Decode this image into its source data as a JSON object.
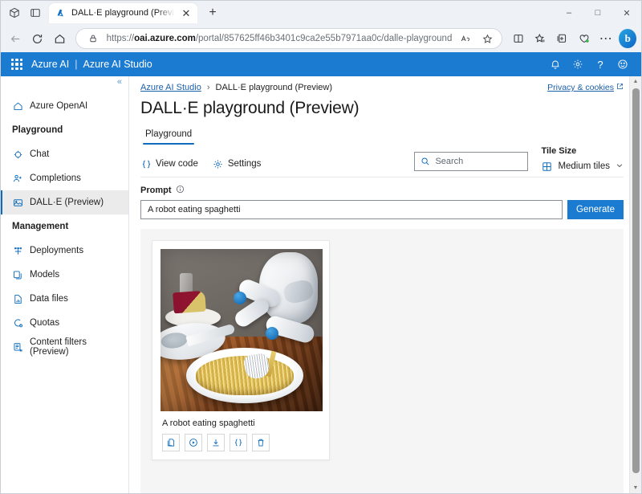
{
  "browser": {
    "tab": {
      "title": "DALL·E playground (Preview) | A…",
      "favicon_icon": "azure-logo-icon",
      "close_icon": "close-icon"
    },
    "new_tab_icon": "plus-icon",
    "tab_search_icon": "tab-search-icon",
    "tab_actions_icon": "tab-actions-icon",
    "nav": {
      "back_icon": "arrow-left-icon",
      "refresh_icon": "refresh-icon",
      "home_icon": "home-icon"
    },
    "omnibox": {
      "lock_icon": "lock-icon",
      "url_prefix": "https://",
      "url_domain": "oai.azure.com",
      "url_path": "/portal/857625ff46b3401c9ca2e55b7971aa0c/dalle-playground",
      "read_aloud_icon": "read-aloud-icon",
      "favorite_icon": "star-icon"
    },
    "toolbar_icons": [
      "split-screen-icon",
      "favorites-icon",
      "collections-icon",
      "browser-essentials-icon",
      "settings-more-icon",
      "copilot-icon"
    ],
    "window_controls": {
      "minimize": "–",
      "maximize": "□",
      "close": "✕"
    }
  },
  "azure_header": {
    "waffle_icon": "app-launcher-icon",
    "brand": "Azure AI",
    "separator": "|",
    "product": "Azure AI Studio",
    "actions": [
      {
        "name": "notifications-icon",
        "glyph": "⮝"
      },
      {
        "name": "settings-gear-icon",
        "glyph": "⚙"
      },
      {
        "name": "help-icon",
        "glyph": "?"
      },
      {
        "name": "feedback-icon",
        "glyph": "☺"
      }
    ]
  },
  "sidebar": {
    "collapse_icon": "chevron-double-left-icon",
    "collapse_glyph": "«",
    "items": [
      {
        "label": "Azure OpenAI",
        "icon": "home-icon",
        "type": "link",
        "active": false
      },
      {
        "label": "Playground",
        "type": "group"
      },
      {
        "label": "Chat",
        "icon": "chat-icon",
        "type": "link",
        "active": false
      },
      {
        "label": "Completions",
        "icon": "completions-icon",
        "type": "link",
        "active": false
      },
      {
        "label": "DALL·E (Preview)",
        "icon": "image-icon",
        "type": "link",
        "active": true
      },
      {
        "label": "Management",
        "type": "group"
      },
      {
        "label": "Deployments",
        "icon": "deployments-icon",
        "type": "link",
        "active": false
      },
      {
        "label": "Models",
        "icon": "models-icon",
        "type": "link",
        "active": false
      },
      {
        "label": "Data files",
        "icon": "data-files-icon",
        "type": "link",
        "active": false
      },
      {
        "label": "Quotas",
        "icon": "quotas-icon",
        "type": "link",
        "active": false
      },
      {
        "label": "Content filters (Preview)",
        "icon": "content-filters-icon",
        "type": "link",
        "active": false
      }
    ]
  },
  "main": {
    "breadcrumb": {
      "root": "Azure AI Studio",
      "separator": "›",
      "current": "DALL·E playground (Preview)"
    },
    "privacy_link": {
      "label": "Privacy & cookies",
      "external_icon": "external-link-icon"
    },
    "page_title": "DALL·E playground (Preview)",
    "tabs": [
      {
        "label": "Playground",
        "selected": true
      }
    ],
    "toolbar": {
      "view_code": {
        "label": "View code",
        "icon": "code-braces-icon"
      },
      "settings": {
        "label": "Settings",
        "icon": "gear-icon"
      }
    },
    "search": {
      "placeholder": "Search",
      "value": "",
      "icon": "search-icon"
    },
    "tile_size": {
      "label": "Tile Size",
      "value": "Medium tiles",
      "grid_icon": "grid-icon",
      "chevron_icon": "chevron-down-icon"
    },
    "prompt": {
      "label": "Prompt",
      "info_icon": "info-icon",
      "value": "A robot eating spaghetti",
      "placeholder": "",
      "generate_label": "Generate"
    },
    "gallery": {
      "cards": [
        {
          "caption": "A robot eating spaghetti",
          "image_alt": "A white humanoid robot sitting at a wooden table eating a plate of spaghetti with a fork",
          "actions": [
            {
              "name": "copy-icon",
              "glyph": "⧉",
              "title": "Copy"
            },
            {
              "name": "generate-variation-icon",
              "glyph": "▶",
              "title": "Generate variation"
            },
            {
              "name": "download-icon",
              "glyph": "↓",
              "title": "Download"
            },
            {
              "name": "view-code-icon",
              "glyph": "{}",
              "title": "View code"
            },
            {
              "name": "delete-icon",
              "glyph": "🗑",
              "title": "Delete"
            }
          ]
        }
      ]
    }
  },
  "colors": {
    "azure_blue": "#1a7bd1",
    "accent_blue": "#0f6cbd",
    "link_blue": "#1a5fa8",
    "chrome_bg": "#eef1f5",
    "gallery_bg": "#f5f5f5",
    "active_nav_bg": "#ebebeb"
  },
  "scrollbar": {
    "up_arrow": "▲",
    "down_arrow": "▼"
  }
}
